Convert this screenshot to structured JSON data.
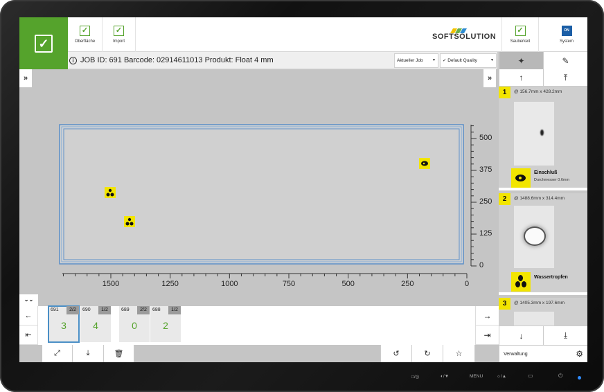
{
  "toolbar": {
    "surface_label": "Oberfläche",
    "import_label": "Import",
    "cleanliness_label": "Sauberkeit",
    "system_label": "System",
    "system_badge": "ON",
    "logo_text": "SOFTSOLUTION"
  },
  "info": {
    "job_text": "JOB ID: 691 Barcode: 02914611013 Produkt: Float 4 mm",
    "job_dropdown": "Aktueller Job",
    "quality_dropdown": "✓ Default Quality"
  },
  "plot": {
    "x_ticks": [
      "1500",
      "1250",
      "1000",
      "750",
      "500",
      "250",
      "0"
    ],
    "y_ticks": [
      "500",
      "375",
      "250",
      "125",
      "0"
    ]
  },
  "markers": [
    {
      "type": "drops",
      "label": "1"
    },
    {
      "type": "drops",
      "label": "2"
    },
    {
      "type": "inclusion",
      "label": "3"
    }
  ],
  "defects": [
    {
      "num": "1",
      "coord": "@ 156.7mm x 428.2mm",
      "name": "Einschluß",
      "sub": "Durchmesser 0.6mm"
    },
    {
      "num": "2",
      "coord": "@ 1488.6mm x 314.4mm",
      "name": "Wassertropfen",
      "sub": ""
    },
    {
      "num": "3",
      "coord": "@ 1405.3mm x 197.6mm",
      "name": "",
      "sub": ""
    }
  ],
  "jobs": [
    {
      "id": "691",
      "count": "2/2",
      "value": "3"
    },
    {
      "id": "690",
      "count": "1/2",
      "value": "4"
    },
    {
      "id": "689",
      "count": "2/2",
      "value": "0"
    },
    {
      "id": "688",
      "count": "1/2",
      "value": "2"
    }
  ],
  "footer": {
    "verwaltung_label": "Verwaltung"
  },
  "hardware": {
    "source": "□/◎",
    "brightness": "◐/▼",
    "menu": "MENU",
    "settings": "☼/▲"
  },
  "colors": {
    "ok_green": "#55a32c",
    "marker_yellow": "#f2e500",
    "selection_blue": "#4a8fc6"
  }
}
